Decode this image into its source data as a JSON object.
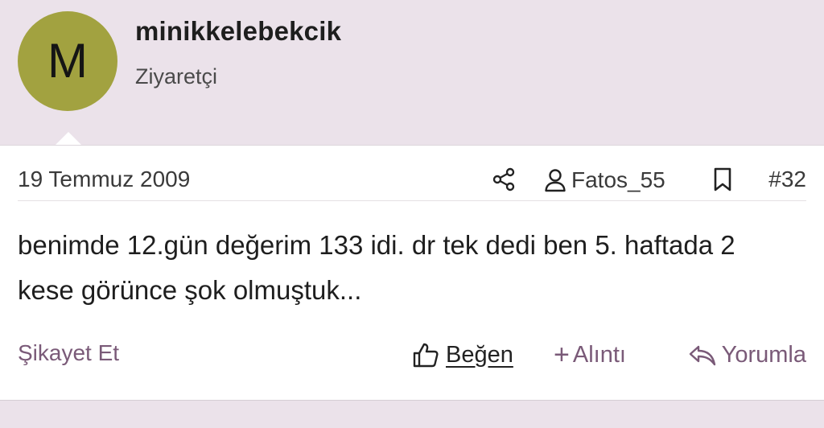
{
  "user": {
    "avatar_letter": "M",
    "name": "minikkelebekcik",
    "title": "Ziyaretçi"
  },
  "post": {
    "date": "19 Temmuz 2009",
    "quoted_user": "Fatos_55",
    "number": "#32",
    "body": "benimde 12.gün değerim 133 idi. dr tek dedi ben 5. haftada 2 kese görünce şok olmuştuk..."
  },
  "actions": {
    "report": "Şikayet Et",
    "like": "Beğen",
    "quote": "Alıntı",
    "quote_prefix": "+",
    "reply": "Yorumla"
  },
  "colors": {
    "background": "#ebe2ea",
    "avatar": "#a2a240",
    "accent": "#7a5a78"
  },
  "icons": {
    "share": "share-icon",
    "user": "user-icon",
    "bookmark": "bookmark-icon",
    "like": "thumbs-up-icon",
    "reply": "reply-icon"
  }
}
